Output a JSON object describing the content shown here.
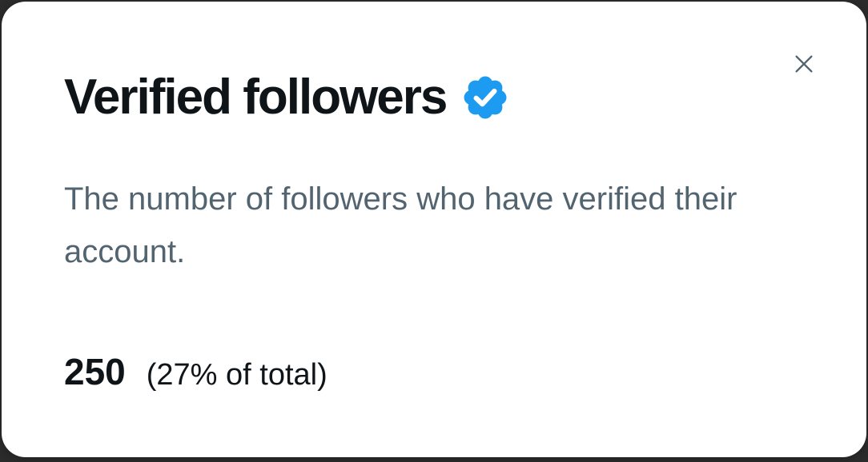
{
  "dialog": {
    "title": "Verified followers",
    "description": "The number of followers who have verified their account.",
    "value": "250",
    "detail": "(27% of total)"
  },
  "icons": {
    "close": "close-icon",
    "badge": "verified-badge-icon"
  },
  "colors": {
    "title": "#0f1419",
    "description": "#536471",
    "badge": "#1d9bf0",
    "close": "#536471",
    "card": "#ffffff"
  }
}
